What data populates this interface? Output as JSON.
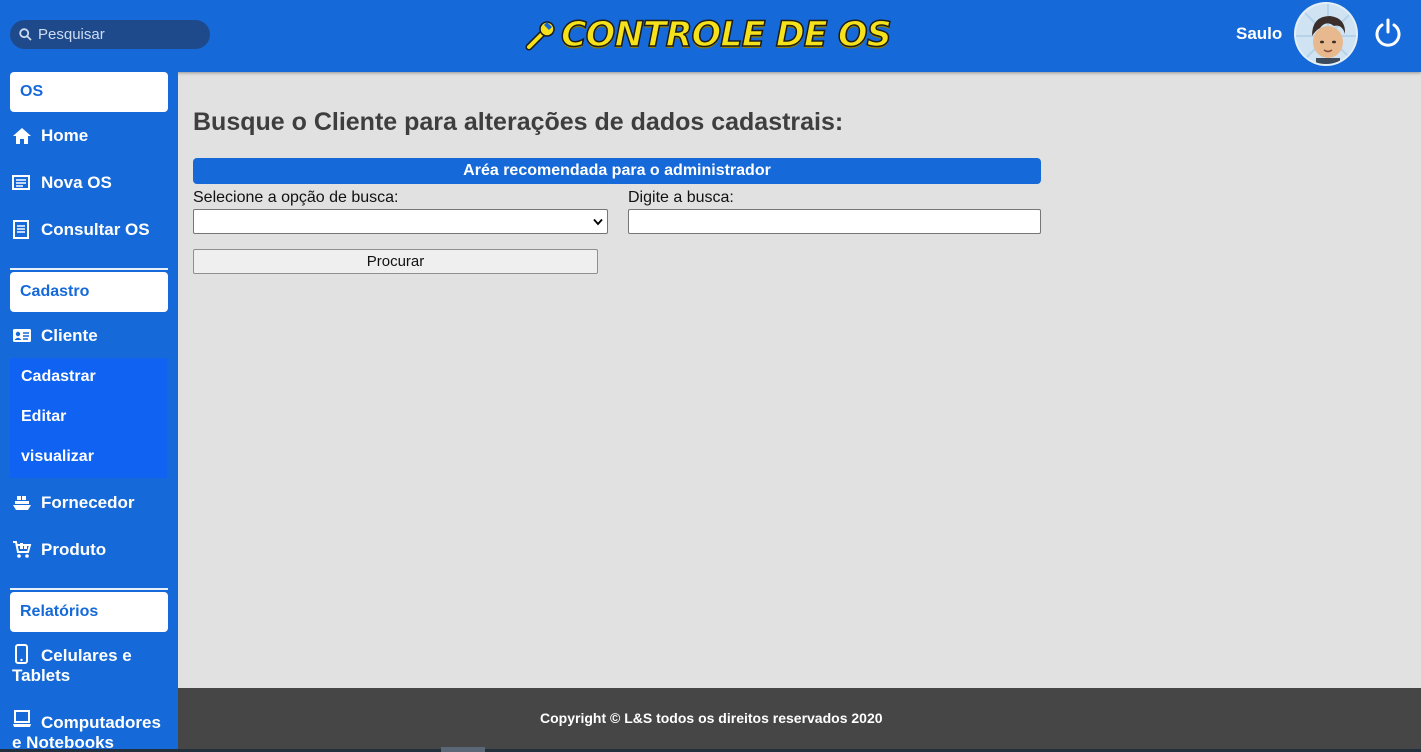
{
  "header": {
    "search_placeholder": "Pesquisar",
    "logo_text": "CONTROLE DE OS",
    "user_name": "Saulo"
  },
  "sidebar": {
    "sections": [
      {
        "label": "OS"
      },
      {
        "label": "Cadastro"
      },
      {
        "label": "Relatórios"
      }
    ],
    "os_items": [
      {
        "label": "Home",
        "icon": "home-icon"
      },
      {
        "label": "Nova OS",
        "icon": "document-icon"
      },
      {
        "label": "Consultar OS",
        "icon": "list-document-icon"
      }
    ],
    "cadastro_items": [
      {
        "label": "Cliente",
        "icon": "id-card-icon"
      },
      {
        "label": "Fornecedor",
        "icon": "ship-icon"
      },
      {
        "label": "Produto",
        "icon": "cart-icon"
      }
    ],
    "cliente_submenu": [
      "Cadastrar",
      "Editar",
      "visualizar"
    ],
    "relatorios_items": [
      {
        "label": "Celulares e Tablets",
        "icon": "mobile-icon"
      },
      {
        "label": "Computadores e Notebooks",
        "icon": "laptop-icon"
      }
    ]
  },
  "main": {
    "title": "Busque o Cliente para alterações de dados cadastrais:",
    "admin_notice": "Aréa recomendada para o administrador",
    "select_label": "Selecione a opção de busca:",
    "select_value": "",
    "search_label": "Digite a busca:",
    "search_value": "",
    "submit_label": "Procurar"
  },
  "footer": {
    "copyright": "Copyright © L&S todos os direitos reservados 2020"
  },
  "colors": {
    "primary": "#1569d8",
    "submenu": "#0f62f2",
    "background": "#e1e1e1",
    "footer": "#464646",
    "logo": "#f6e21a"
  }
}
